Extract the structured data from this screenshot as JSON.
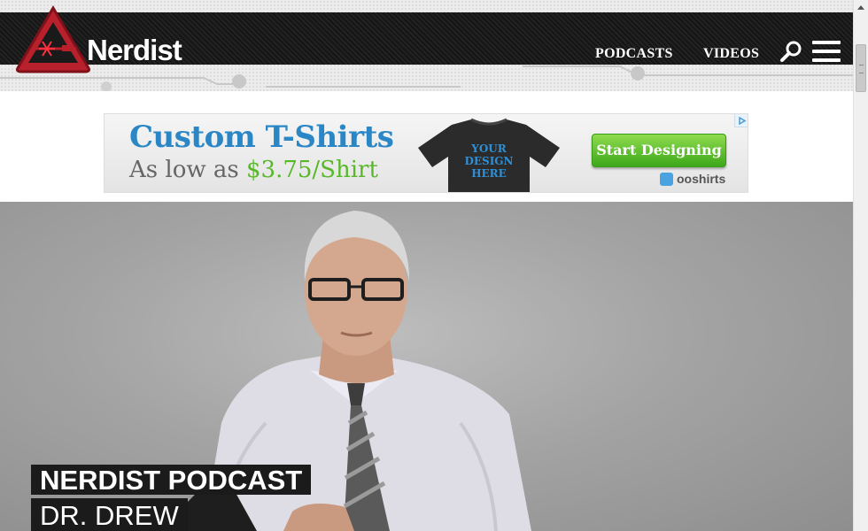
{
  "site": {
    "logo_text": "Nerdist",
    "brand_color": "#b8202c"
  },
  "nav": {
    "items": [
      {
        "label": "PODCASTS"
      },
      {
        "label": "VIDEOS"
      }
    ],
    "search_icon": "search-icon",
    "menu_icon": "hamburger-menu-icon"
  },
  "ad": {
    "headline": "Custom T-Shirts",
    "sub_prefix": "As low as ",
    "sub_price": "$3.75/Shirt",
    "shirt_text_1": "YOUR",
    "shirt_text_2": "DESIGN",
    "shirt_text_3": "HERE",
    "cta_label": "Start Designing",
    "brand": "ooshirts",
    "headline_color": "#2b86c5",
    "price_color": "#58b828"
  },
  "hero": {
    "kicker": "NERDIST PODCAST",
    "title": "DR. DREW"
  }
}
